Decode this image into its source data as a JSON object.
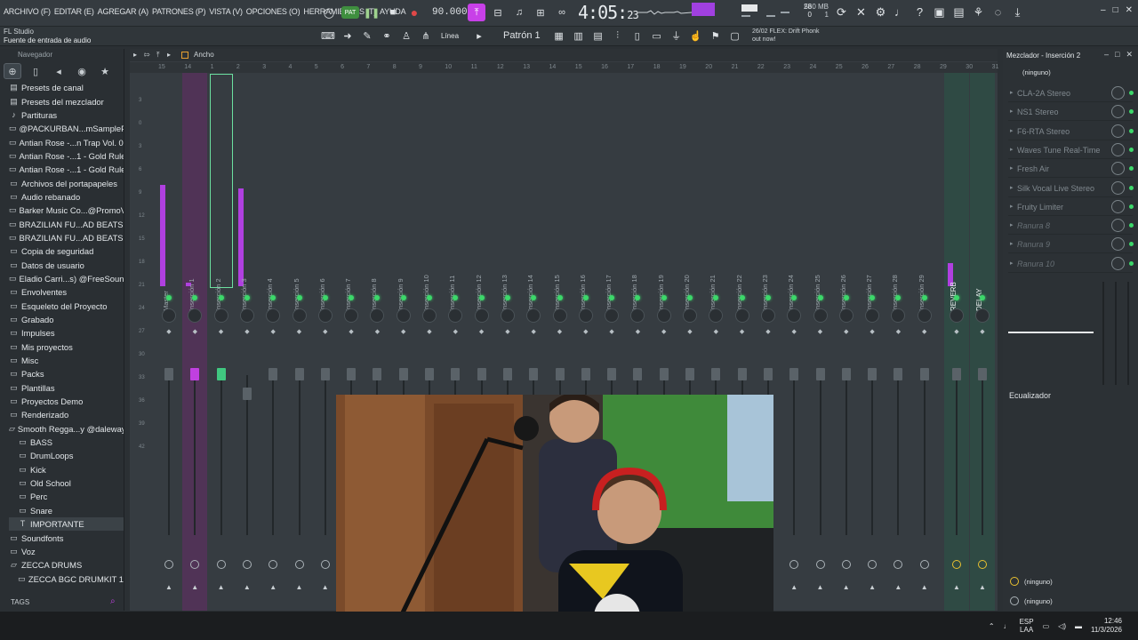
{
  "menus": [
    "ARCHIVO (F)",
    "EDITAR (E)",
    "AGREGAR (A)",
    "PATRONES (P)",
    "VISTA (V)",
    "OPCIONES (O)",
    "HERRAMIENTAS (T)",
    "AYUDA"
  ],
  "transport": {
    "pat_label": "PAT",
    "tempo": "90.000",
    "song_time_main": "4:05:",
    "song_time_sub": "23"
  },
  "cpu": {
    "value": "28",
    "poly": "0"
  },
  "memory": {
    "value": "560 MB",
    "voices": "1"
  },
  "hint": {
    "app": "FL Studio",
    "text": "Fuente de entrada de audio"
  },
  "toolbar": {
    "snap": "Línea",
    "pattern": "Patrón 1"
  },
  "news": {
    "date": "26/02",
    "line1": "FLEX: Drift Phonk",
    "line2": "out now!"
  },
  "browser": {
    "title": "Navegador",
    "items": [
      {
        "label": "Presets de canal",
        "icon": "preset-icon",
        "sub": false
      },
      {
        "label": "Presets del mezclador",
        "icon": "preset-icon",
        "sub": false
      },
      {
        "label": "Partituras",
        "icon": "score-icon",
        "sub": false
      },
      {
        "label": "@PACKURBAN...mSamplePacks",
        "icon": "folder-icon",
        "sub": false
      },
      {
        "label": "Antian Rose -...n Trap Vol. 03",
        "icon": "folder-icon",
        "sub": false
      },
      {
        "label": "Antian Rose -...1 - Gold Rulez",
        "icon": "folder-icon",
        "sub": false
      },
      {
        "label": "Antian Rose -...1 - Gold Rulez",
        "icon": "folder-icon",
        "sub": false
      },
      {
        "label": "Archivos del portapapeles",
        "icon": "folder-icon",
        "sub": false
      },
      {
        "label": "Audio rebanado",
        "icon": "folder-icon",
        "sub": false
      },
      {
        "label": "Barker Music Co...@PromoViDo",
        "icon": "folder-icon",
        "sub": false
      },
      {
        "label": "BRAZILIAN FU...AD BEATS 2024",
        "icon": "folder-icon",
        "sub": false
      },
      {
        "label": "BRAZILIAN FU...AD BEATS 2024",
        "icon": "folder-icon",
        "sub": false
      },
      {
        "label": "Copia de seguridad",
        "icon": "folder-icon",
        "sub": false
      },
      {
        "label": "Datos de usuario",
        "icon": "folder-icon",
        "sub": false
      },
      {
        "label": "Eladio Carri...s) @FreeSounds1",
        "icon": "folder-icon",
        "sub": false
      },
      {
        "label": "Envolventes",
        "icon": "folder-icon",
        "sub": false
      },
      {
        "label": "Esqueleto del Proyecto",
        "icon": "folder-icon",
        "sub": false
      },
      {
        "label": "Grabado",
        "icon": "folder-icon",
        "sub": false
      },
      {
        "label": "Impulses",
        "icon": "folder-icon",
        "sub": false
      },
      {
        "label": "Mis proyectos",
        "icon": "folder-icon",
        "sub": false
      },
      {
        "label": "Misc",
        "icon": "folder-icon",
        "sub": false
      },
      {
        "label": "Packs",
        "icon": "folder-icon",
        "sub": false
      },
      {
        "label": "Plantillas",
        "icon": "folder-icon",
        "sub": false
      },
      {
        "label": "Proyectos Demo",
        "icon": "folder-icon",
        "sub": false
      },
      {
        "label": "Renderizado",
        "icon": "folder-icon",
        "sub": false
      },
      {
        "label": "Smooth Regga...y @dalewaya",
        "icon": "folder-open-icon",
        "sub": false
      },
      {
        "label": "BASS",
        "icon": "folder-icon",
        "sub": true
      },
      {
        "label": "DrumLoops",
        "icon": "folder-icon",
        "sub": true
      },
      {
        "label": "Kick",
        "icon": "folder-icon",
        "sub": true
      },
      {
        "label": "Old School",
        "icon": "folder-icon",
        "sub": true
      },
      {
        "label": "Perc",
        "icon": "folder-icon",
        "sub": true
      },
      {
        "label": "Snare",
        "icon": "folder-icon",
        "sub": true
      },
      {
        "label": "IMPORTANTE",
        "icon": "text-icon",
        "sub": true
      },
      {
        "label": "Soundfonts",
        "icon": "folder-icon",
        "sub": false
      },
      {
        "label": "Voz",
        "icon": "folder-icon",
        "sub": false
      },
      {
        "label": "ZECCA DRUMS",
        "icon": "folder-open-icon",
        "sub": false
      },
      {
        "label": "ZECCA BGC DRUMKIT 1",
        "icon": "folder-icon",
        "sub": true
      }
    ],
    "tags_label": "TAGS"
  },
  "mixer": {
    "view_label": "Ancho",
    "ruler": [
      "15",
      "14",
      "1",
      "2",
      "3",
      "4",
      "5",
      "6",
      "7",
      "8",
      "9",
      "10",
      "11",
      "12",
      "13",
      "14",
      "15",
      "16",
      "17",
      "18",
      "19",
      "20",
      "21",
      "22",
      "23",
      "24",
      "25",
      "26",
      "27",
      "28",
      "29",
      "30",
      "31"
    ],
    "meter_labels": [
      "3",
      "0",
      "3",
      "6",
      "9",
      "12",
      "15",
      "18",
      "21",
      "24",
      "27",
      "30",
      "33",
      "36",
      "39",
      "42"
    ],
    "tracks": [
      {
        "name": "Master",
        "state": "normal",
        "meter": 0.52,
        "fader": 0.0
      },
      {
        "name": "Inserción 1",
        "state": "selected",
        "meter": 0.02,
        "fader": 0.0
      },
      {
        "name": "Inserción 2",
        "state": "current",
        "meter": 0.0,
        "fader": 0.0
      },
      {
        "name": "Inserción 3",
        "state": "normal",
        "meter": 0.5,
        "fader": 0.12
      },
      {
        "name": "Inserción 4",
        "state": "normal",
        "meter": 0,
        "fader": 0
      },
      {
        "name": "Inserción 5",
        "state": "normal",
        "meter": 0,
        "fader": 0
      },
      {
        "name": "Inserción 6",
        "state": "normal",
        "meter": 0,
        "fader": 0
      },
      {
        "name": "Inserción 7",
        "state": "normal",
        "meter": 0,
        "fader": 0
      },
      {
        "name": "Inserción 8",
        "state": "normal",
        "meter": 0,
        "fader": 0
      },
      {
        "name": "Inserción 9",
        "state": "normal",
        "meter": 0,
        "fader": 0
      },
      {
        "name": "Inserción 10",
        "state": "normal",
        "meter": 0,
        "fader": 0
      },
      {
        "name": "Inserción 11",
        "state": "normal",
        "meter": 0,
        "fader": 0
      },
      {
        "name": "Inserción 12",
        "state": "normal",
        "meter": 0,
        "fader": 0
      },
      {
        "name": "Inserción 13",
        "state": "normal",
        "meter": 0,
        "fader": 0
      },
      {
        "name": "Inserción 14",
        "state": "normal",
        "meter": 0,
        "fader": 0
      },
      {
        "name": "Inserción 15",
        "state": "normal",
        "meter": 0,
        "fader": 0
      },
      {
        "name": "Inserción 16",
        "state": "normal",
        "meter": 0,
        "fader": 0
      },
      {
        "name": "Inserción 17",
        "state": "normal",
        "meter": 0,
        "fader": 0
      },
      {
        "name": "Inserción 18",
        "state": "normal",
        "meter": 0,
        "fader": 0
      },
      {
        "name": "Inserción 19",
        "state": "normal",
        "meter": 0,
        "fader": 0
      },
      {
        "name": "Inserción 20",
        "state": "normal",
        "meter": 0,
        "fader": 0
      },
      {
        "name": "Inserción 21",
        "state": "normal",
        "meter": 0,
        "fader": 0
      },
      {
        "name": "Inserción 22",
        "state": "normal",
        "meter": 0,
        "fader": 0
      },
      {
        "name": "Inserción 23",
        "state": "normal",
        "meter": 0,
        "fader": 0
      },
      {
        "name": "Inserción 24",
        "state": "normal",
        "meter": 0,
        "fader": 0
      },
      {
        "name": "Inserción 25",
        "state": "normal",
        "meter": 0,
        "fader": 0
      },
      {
        "name": "Inserción 26",
        "state": "normal",
        "meter": 0,
        "fader": 0
      },
      {
        "name": "Inserción 27",
        "state": "normal",
        "meter": 0,
        "fader": 0
      },
      {
        "name": "Inserción 28",
        "state": "normal",
        "meter": 0,
        "fader": 0
      },
      {
        "name": "Inserción 29",
        "state": "normal",
        "meter": 0,
        "fader": 0
      },
      {
        "name": "REVERB",
        "state": "bus",
        "meter": 0.12,
        "fader": 0
      },
      {
        "name": "DELAY",
        "state": "bus",
        "meter": 0,
        "fader": 0
      }
    ]
  },
  "inserts_panel": {
    "title": "Mezclador - Inserción 2",
    "input": "(ninguno)",
    "slots": [
      "CLA-2A Stereo",
      "NS1 Stereo",
      "F6-RTA Stereo",
      "Waves Tune Real-Time",
      "Fresh Air",
      "Silk Vocal Live Stereo",
      "Fruity Limiter",
      "Ranura 8",
      "Ranura 9",
      "Ranura 10"
    ],
    "eq_label": "Ecualizador",
    "output1": "(ninguno)",
    "output2": "(ninguno)"
  },
  "taskbar": {
    "lang1": "ESP",
    "lang2": "LAA",
    "time": "12:46",
    "date": "11/3/2026"
  },
  "colors": {
    "accent": "#b040e0",
    "green": "#3cd86a",
    "bg": "#363c41"
  }
}
